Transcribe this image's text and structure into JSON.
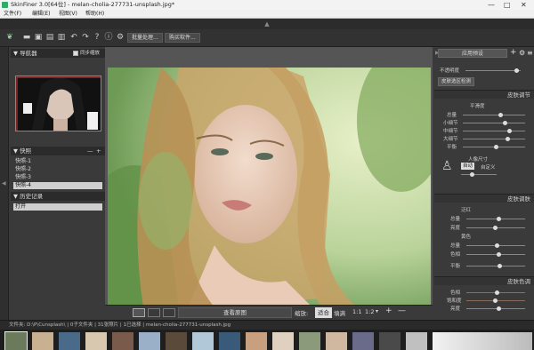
{
  "window": {
    "title": "SkinFiner 3.0[64位] - melan-cholia-277731-unsplash.jpg*"
  },
  "menu": [
    "文件(F)",
    "编辑(E)",
    "视图(V)",
    "帮助(H)"
  ],
  "toolbar": {
    "batch_label": "批量处理...",
    "buy_label": "购买软件..."
  },
  "left_panel": {
    "navigator_title": "导航器",
    "sync_label": "同步缩放",
    "snapshots_title": "快照",
    "snapshots": [
      "快照-1",
      "快照-2",
      "快照-3",
      "快照-4"
    ],
    "history_title": "历史记录",
    "history": [
      "打开"
    ]
  },
  "bottom_bar": {
    "view_original": "查看原图",
    "zoom_label": "缩放:",
    "fit_label": "适合",
    "fill_label": "填满",
    "ratio1": "1:1",
    "ratio2": "1:2"
  },
  "right_panel": {
    "preset_label": "应用预设",
    "opacity_label": "不透明度",
    "skin_detect_label": "皮肤选区检测",
    "skin_smooth_title": "皮肤调节",
    "smooth_strength_label": "平滑度",
    "smooth_sliders": [
      "总量",
      "小细节",
      "中细节",
      "大细节",
      "平衡"
    ],
    "portrait_label": "人像尺寸",
    "auto_label": "自动",
    "custom_label": "自定义",
    "skin_tone_title": "皮肤调肤",
    "redness_label": "泛红",
    "red_sliders": [
      "总量",
      "亮度"
    ],
    "yellow_label": "黄色",
    "yellow_sliders": [
      "总量",
      "色相"
    ],
    "balance_label": "平衡",
    "skin_color_title": "皮肤色调",
    "color_sliders": [
      "色相",
      "饱和度",
      "亮度"
    ]
  },
  "status": "文件夹: D:\\P\\Cunsplash\\ | 0子文件夹 | 31张照片 | 1已选择 | melan-cholia-277731-unsplash.jpg",
  "filmstrip_count": 16
}
